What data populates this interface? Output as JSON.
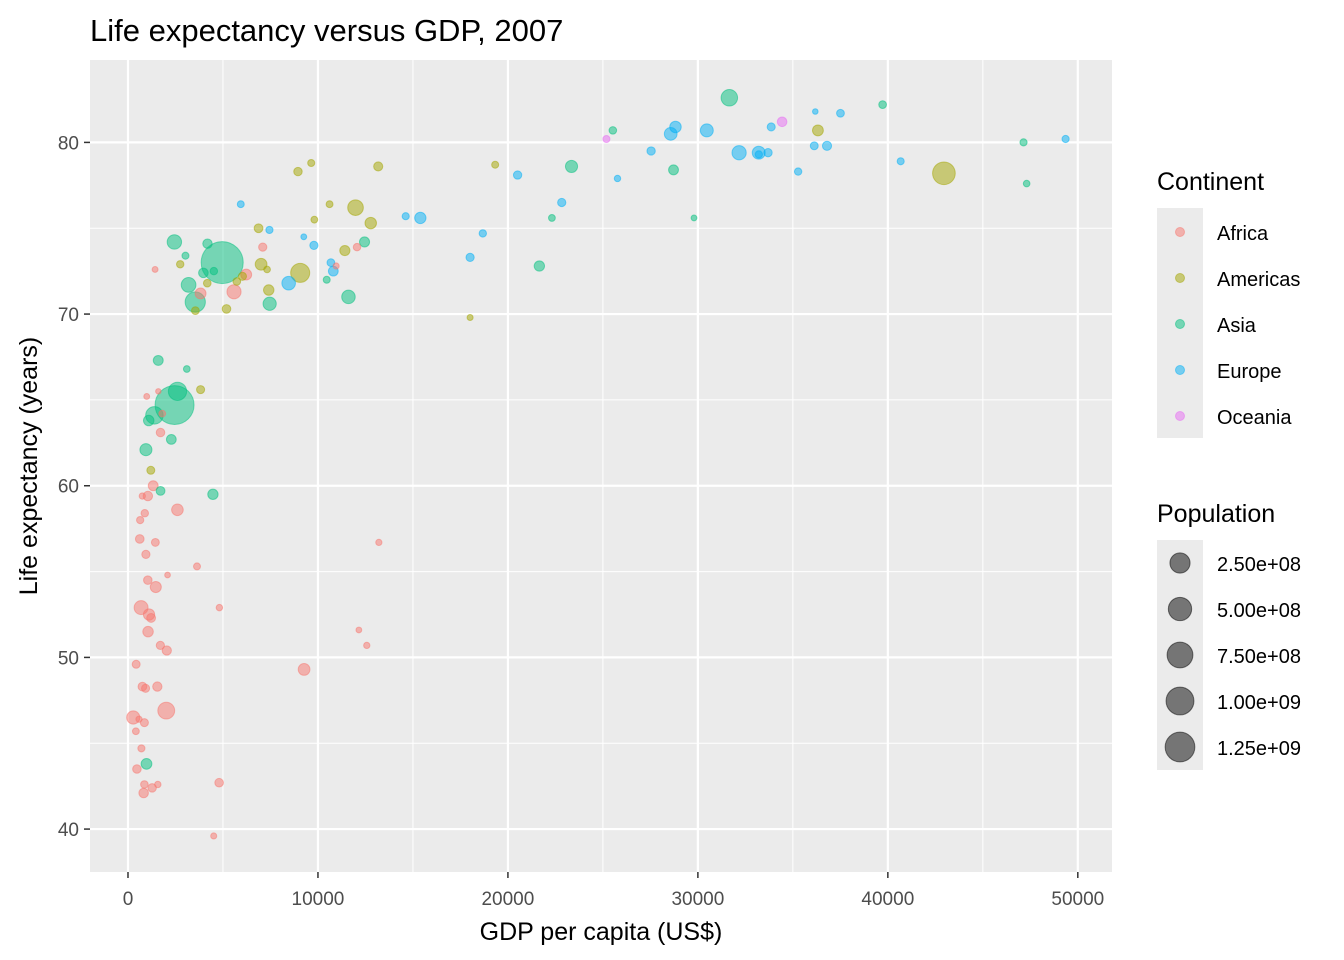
{
  "chart_data": {
    "type": "scatter",
    "title": "Life expectancy versus GDP, 2007",
    "xlabel": "GDP per capita (US$)",
    "ylabel": "Life expectancy (years)",
    "xlim": [
      -2000,
      51800
    ],
    "ylim": [
      37.5,
      84.8
    ],
    "xticks": [
      0,
      10000,
      20000,
      30000,
      40000,
      50000
    ],
    "xtick_labels": [
      "0",
      "10000",
      "20000",
      "30000",
      "40000",
      "50000"
    ],
    "yticks": [
      40,
      50,
      60,
      70,
      80
    ],
    "ytick_labels": [
      "40",
      "50",
      "60",
      "70",
      "80"
    ],
    "grid": true,
    "color_legend": {
      "title": "Continent",
      "placement": "right",
      "entries": [
        {
          "label": "Africa",
          "color": "#F8766D"
        },
        {
          "label": "Americas",
          "color": "#A3A500"
        },
        {
          "label": "Asia",
          "color": "#00BF7D"
        },
        {
          "label": "Europe",
          "color": "#00B0F6"
        },
        {
          "label": "Oceania",
          "color": "#E76BF3"
        }
      ]
    },
    "size_legend": {
      "title": "Population",
      "placement": "right",
      "entries": [
        {
          "label": "2.50e+08",
          "value": 250000000
        },
        {
          "label": "5.00e+08",
          "value": 500000000
        },
        {
          "label": "7.50e+08",
          "value": 750000000
        },
        {
          "label": "1.00e+09",
          "value": 1000000000
        },
        {
          "label": "1.25e+09",
          "value": 1250000000
        }
      ]
    },
    "columns": [
      "gdpPercap",
      "lifeExp",
      "pop",
      "continent"
    ],
    "points": [
      [
        974,
        43.8,
        31889923,
        "Asia"
      ],
      [
        5937,
        76.4,
        3600523,
        "Europe"
      ],
      [
        6223,
        72.3,
        33333216,
        "Africa"
      ],
      [
        4797,
        42.7,
        12420476,
        "Africa"
      ],
      [
        12779,
        75.3,
        40301927,
        "Americas"
      ],
      [
        34435,
        81.2,
        20434176,
        "Oceania"
      ],
      [
        36126,
        79.8,
        8199783,
        "Europe"
      ],
      [
        29796,
        75.6,
        708573,
        "Asia"
      ],
      [
        1391,
        64.1,
        150448339,
        "Asia"
      ],
      [
        33693,
        79.4,
        10392226,
        "Europe"
      ],
      [
        1441,
        56.7,
        8078314,
        "Africa"
      ],
      [
        3822,
        65.6,
        9119152,
        "Americas"
      ],
      [
        7446,
        74.9,
        4552198,
        "Europe"
      ],
      [
        12570,
        50.7,
        1639131,
        "Africa"
      ],
      [
        9065,
        72.4,
        190010647,
        "Americas"
      ],
      [
        10681,
        73.0,
        7322858,
        "Europe"
      ],
      [
        1217,
        52.3,
        14326203,
        "Africa"
      ],
      [
        430,
        49.6,
        8390505,
        "Africa"
      ],
      [
        1714,
        59.7,
        14131858,
        "Asia"
      ],
      [
        2042,
        50.4,
        17696293,
        "Africa"
      ],
      [
        36319,
        80.7,
        33390141,
        "Americas"
      ],
      [
        706,
        44.7,
        4369038,
        "Africa"
      ],
      [
        1704,
        50.7,
        10238807,
        "Africa"
      ],
      [
        13172,
        78.6,
        16284741,
        "Americas"
      ],
      [
        4959,
        73.0,
        1318683096,
        "Asia"
      ],
      [
        7007,
        72.9,
        44227550,
        "Americas"
      ],
      [
        986,
        65.2,
        710960,
        "Africa"
      ],
      [
        278,
        46.5,
        64606759,
        "Africa"
      ],
      [
        3633,
        55.3,
        3800610,
        "Africa"
      ],
      [
        9645,
        78.8,
        4133884,
        "Americas"
      ],
      [
        1545,
        48.3,
        18013409,
        "Africa"
      ],
      [
        14619,
        75.7,
        4493312,
        "Europe"
      ],
      [
        8948,
        78.3,
        11416987,
        "Americas"
      ],
      [
        22833,
        76.5,
        10228744,
        "Europe"
      ],
      [
        35278,
        78.3,
        5468120,
        "Europe"
      ],
      [
        2082,
        54.8,
        496374,
        "Africa"
      ],
      [
        6025,
        72.2,
        9319622,
        "Americas"
      ],
      [
        6873,
        75.0,
        13755680,
        "Americas"
      ],
      [
        5581,
        71.3,
        80264543,
        "Africa"
      ],
      [
        5728,
        71.9,
        6939688,
        "Americas"
      ],
      [
        12154,
        51.6,
        551201,
        "Africa"
      ],
      [
        641,
        58.0,
        4906585,
        "Africa"
      ],
      [
        690,
        52.9,
        76511887,
        "Africa"
      ],
      [
        33207,
        79.3,
        5238460,
        "Europe"
      ],
      [
        30470,
        80.7,
        61083916,
        "Europe"
      ],
      [
        13206,
        56.7,
        1454867,
        "Africa"
      ],
      [
        753,
        59.4,
        1688359,
        "Africa"
      ],
      [
        32170,
        79.4,
        82400996,
        "Europe"
      ],
      [
        1327,
        60.0,
        22873338,
        "Africa"
      ],
      [
        27538,
        79.5,
        10706290,
        "Europe"
      ],
      [
        5186,
        70.3,
        12572928,
        "Americas"
      ],
      [
        943,
        56.0,
        9947814,
        "Africa"
      ],
      [
        579,
        46.4,
        1472041,
        "Africa"
      ],
      [
        1202,
        60.9,
        8502814,
        "Americas"
      ],
      [
        3548,
        70.2,
        7483763,
        "Americas"
      ],
      [
        39725,
        82.2,
        6980412,
        "Asia"
      ],
      [
        18009,
        73.3,
        9956108,
        "Europe"
      ],
      [
        36181,
        81.8,
        301931,
        "Europe"
      ],
      [
        2452,
        64.7,
        1110396331,
        "Asia"
      ],
      [
        3541,
        70.7,
        223547000,
        "Asia"
      ],
      [
        11606,
        71.0,
        69453570,
        "Asia"
      ],
      [
        4471,
        59.5,
        27499638,
        "Asia"
      ],
      [
        40676,
        78.9,
        4109086,
        "Europe"
      ],
      [
        25523,
        80.7,
        6426679,
        "Asia"
      ],
      [
        28570,
        80.5,
        58147733,
        "Europe"
      ],
      [
        7321,
        72.6,
        2780132,
        "Americas"
      ],
      [
        31656,
        82.6,
        127467972,
        "Asia"
      ],
      [
        4519,
        72.5,
        6053193,
        "Asia"
      ],
      [
        1463,
        54.1,
        35610177,
        "Africa"
      ],
      [
        1593,
        67.3,
        23301725,
        "Asia"
      ],
      [
        23348,
        78.6,
        49044790,
        "Asia"
      ],
      [
        47307,
        77.6,
        2505559,
        "Asia"
      ],
      [
        10461,
        72.0,
        3921278,
        "Asia"
      ],
      [
        1569,
        42.6,
        2012649,
        "Africa"
      ],
      [
        415,
        45.7,
        3193942,
        "Africa"
      ],
      [
        12057,
        73.9,
        6036914,
        "Africa"
      ],
      [
        1045,
        59.4,
        19167654,
        "Africa"
      ],
      [
        759,
        48.3,
        13327079,
        "Africa"
      ],
      [
        12452,
        74.2,
        24821286,
        "Asia"
      ],
      [
        1043,
        54.5,
        12031795,
        "Africa"
      ],
      [
        1803,
        64.2,
        3270065,
        "Africa"
      ],
      [
        10957,
        72.8,
        1250882,
        "Africa"
      ],
      [
        11978,
        76.2,
        108700891,
        "Americas"
      ],
      [
        3096,
        66.8,
        2874127,
        "Asia"
      ],
      [
        9254,
        74.5,
        684736,
        "Europe"
      ],
      [
        3820,
        71.2,
        33757175,
        "Africa"
      ],
      [
        824,
        42.1,
        19951656,
        "Africa"
      ],
      [
        944,
        62.1,
        47761980,
        "Asia"
      ],
      [
        4811,
        52.9,
        2055080,
        "Africa"
      ],
      [
        1091,
        63.8,
        28901790,
        "Asia"
      ],
      [
        36798,
        79.8,
        16570613,
        "Europe"
      ],
      [
        25185,
        80.2,
        4115771,
        "Oceania"
      ],
      [
        2749,
        72.9,
        5675356,
        "Americas"
      ],
      [
        620,
        56.9,
        12894865,
        "Africa"
      ],
      [
        2014,
        46.9,
        135031164,
        "Africa"
      ],
      [
        49357,
        80.2,
        4627926,
        "Europe"
      ],
      [
        22316,
        75.6,
        3204897,
        "Asia"
      ],
      [
        2606,
        65.5,
        169270617,
        "Asia"
      ],
      [
        9809,
        75.5,
        3242173,
        "Americas"
      ],
      [
        4173,
        71.8,
        6667147,
        "Americas"
      ],
      [
        7409,
        71.4,
        28674757,
        "Americas"
      ],
      [
        3190,
        71.7,
        91077287,
        "Asia"
      ],
      [
        15390,
        75.6,
        38518241,
        "Europe"
      ],
      [
        20510,
        78.1,
        10642836,
        "Europe"
      ],
      [
        19329,
        78.7,
        3942491,
        "Americas"
      ],
      [
        1426,
        72.6,
        798094,
        "Africa"
      ],
      [
        10808,
        72.5,
        22276056,
        "Europe"
      ],
      [
        863,
        46.2,
        8860588,
        "Africa"
      ],
      [
        1598,
        65.5,
        199579,
        "Africa"
      ],
      [
        21655,
        72.8,
        27601038,
        "Asia"
      ],
      [
        1712,
        63.1,
        12267493,
        "Africa"
      ],
      [
        9787,
        74.0,
        10150265,
        "Europe"
      ],
      [
        863,
        42.6,
        6144562,
        "Africa"
      ],
      [
        47143,
        80.0,
        4553009,
        "Asia"
      ],
      [
        18678,
        74.7,
        5447502,
        "Europe"
      ],
      [
        25768,
        77.9,
        2009245,
        "Europe"
      ],
      [
        926,
        48.2,
        9118773,
        "Africa"
      ],
      [
        9270,
        49.3,
        43997828,
        "Africa"
      ],
      [
        28821,
        80.9,
        40448191,
        "Europe"
      ],
      [
        3970,
        72.4,
        20378239,
        "Asia"
      ],
      [
        2602,
        58.6,
        42292929,
        "Africa"
      ],
      [
        4513,
        39.6,
        1133066,
        "Africa"
      ],
      [
        33860,
        80.9,
        9031088,
        "Europe"
      ],
      [
        37506,
        81.7,
        7554661,
        "Europe"
      ],
      [
        4185,
        74.1,
        19314747,
        "Asia"
      ],
      [
        28718,
        78.4,
        23174294,
        "Asia"
      ],
      [
        1107,
        52.5,
        38139640,
        "Africa"
      ],
      [
        7458,
        70.6,
        65068149,
        "Asia"
      ],
      [
        883,
        58.4,
        5701579,
        "Africa"
      ],
      [
        18009,
        69.8,
        1056608,
        "Americas"
      ],
      [
        7093,
        73.9,
        10276158,
        "Africa"
      ],
      [
        8458,
        71.8,
        71158647,
        "Europe"
      ],
      [
        1056,
        51.5,
        29170398,
        "Africa"
      ],
      [
        33203,
        79.4,
        60776238,
        "Europe"
      ],
      [
        42952,
        78.2,
        301139947,
        "Americas"
      ],
      [
        10611,
        76.4,
        3447496,
        "Americas"
      ],
      [
        11416,
        73.7,
        26084662,
        "Americas"
      ],
      [
        2442,
        74.2,
        85262356,
        "Asia"
      ],
      [
        3026,
        73.4,
        4018332,
        "Asia"
      ],
      [
        2281,
        62.7,
        22211743,
        "Asia"
      ],
      [
        1271,
        42.4,
        11746035,
        "Africa"
      ],
      [
        470,
        43.5,
        12311143,
        "Africa"
      ]
    ]
  }
}
